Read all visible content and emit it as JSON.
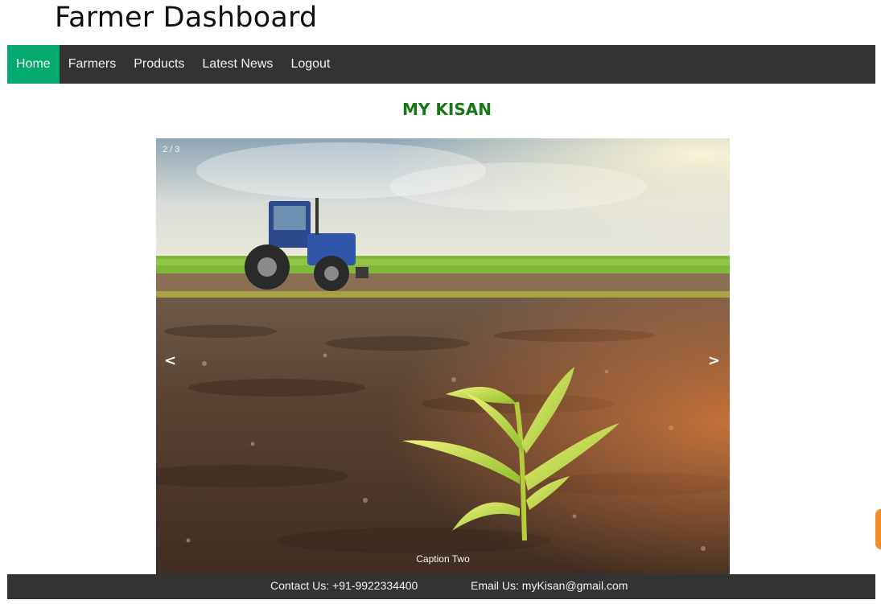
{
  "header": {
    "title": "Farmer Dashboard"
  },
  "nav": {
    "items": [
      {
        "label": "Home",
        "active": true
      },
      {
        "label": "Farmers"
      },
      {
        "label": "Products"
      },
      {
        "label": "Latest News"
      },
      {
        "label": "Logout"
      }
    ]
  },
  "main": {
    "heading": "MY KISAN"
  },
  "slideshow": {
    "counter": "2 / 3",
    "caption": "Caption Two",
    "prev_symbol": "<",
    "next_symbol": ">"
  },
  "footer": {
    "contact": "Contact Us: +91-9922334400",
    "email": "Email Us: myKisan@gmail.com"
  },
  "colors": {
    "nav_bg": "#333333",
    "nav_active": "#04aa6d",
    "heading": "#147814",
    "side_tab": "#f28c28"
  }
}
